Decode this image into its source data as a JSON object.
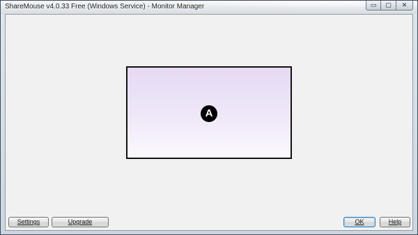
{
  "window": {
    "title": "ShareMouse v4.0.33 Free (Windows Service) - Monitor Manager"
  },
  "caption_buttons": {
    "minimize_glyph": "▭",
    "maximize_glyph": "▢",
    "close_glyph": "✕"
  },
  "monitor": {
    "label": "A",
    "gradient_top": "#e6daf4",
    "gradient_bottom": "#fbf9fe"
  },
  "footer": {
    "settings_label": "Settings",
    "upgrade_label": "Upgrade",
    "ok_label": "OK",
    "help_label": "Help"
  }
}
